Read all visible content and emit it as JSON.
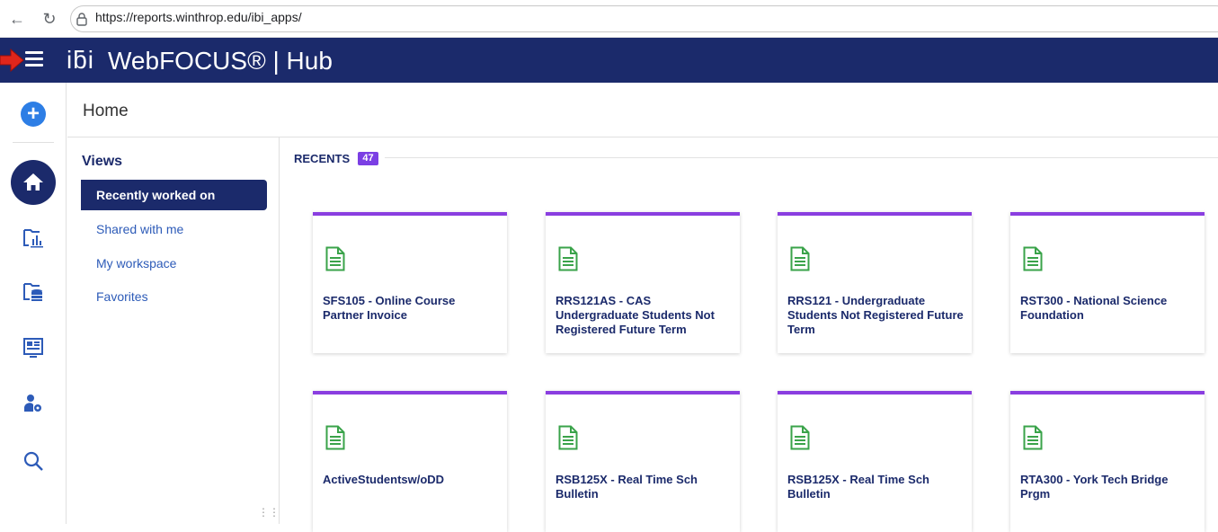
{
  "browser": {
    "url": "https://reports.winthrop.edu/ibi_apps/"
  },
  "header": {
    "logo": "iƃi",
    "app_name": "WebFOCUS® | Hub"
  },
  "page": {
    "title": "Home"
  },
  "views": {
    "heading": "Views",
    "items": [
      {
        "label": "Recently worked on",
        "active": true
      },
      {
        "label": "Shared with me",
        "active": false
      },
      {
        "label": "My workspace",
        "active": false
      },
      {
        "label": "Favorites",
        "active": false
      }
    ]
  },
  "recents": {
    "heading": "RECENTS",
    "count": "47",
    "items": [
      {
        "label": "SFS105 - Online Course Partner Invoice"
      },
      {
        "label": "RRS121AS - CAS Undergraduate Students Not Registered Future Term"
      },
      {
        "label": "RRS121 - Undergraduate Students Not Registered Future Term"
      },
      {
        "label": "RST300 - National Science Foundation"
      },
      {
        "label": "ActiveStudentsw/oDD"
      },
      {
        "label": "RSB125X - Real Time Sch Bulletin"
      },
      {
        "label": "RSB125X - Real Time Sch Bulletin"
      },
      {
        "label": "RTA300 - York Tech Bridge Prgm"
      }
    ]
  },
  "colors": {
    "header_bg": "#1b2a6b",
    "card_accent": "#8a3ee0",
    "badge": "#7b3fe4",
    "doc_icon": "#3aa34a",
    "add_button": "#2d7ee5"
  },
  "icons": {
    "rail": [
      "add-icon",
      "home-icon",
      "reports-icon",
      "workspace-icon",
      "portal-icon",
      "admin-icon",
      "search-icon"
    ],
    "card": "document-icon"
  }
}
